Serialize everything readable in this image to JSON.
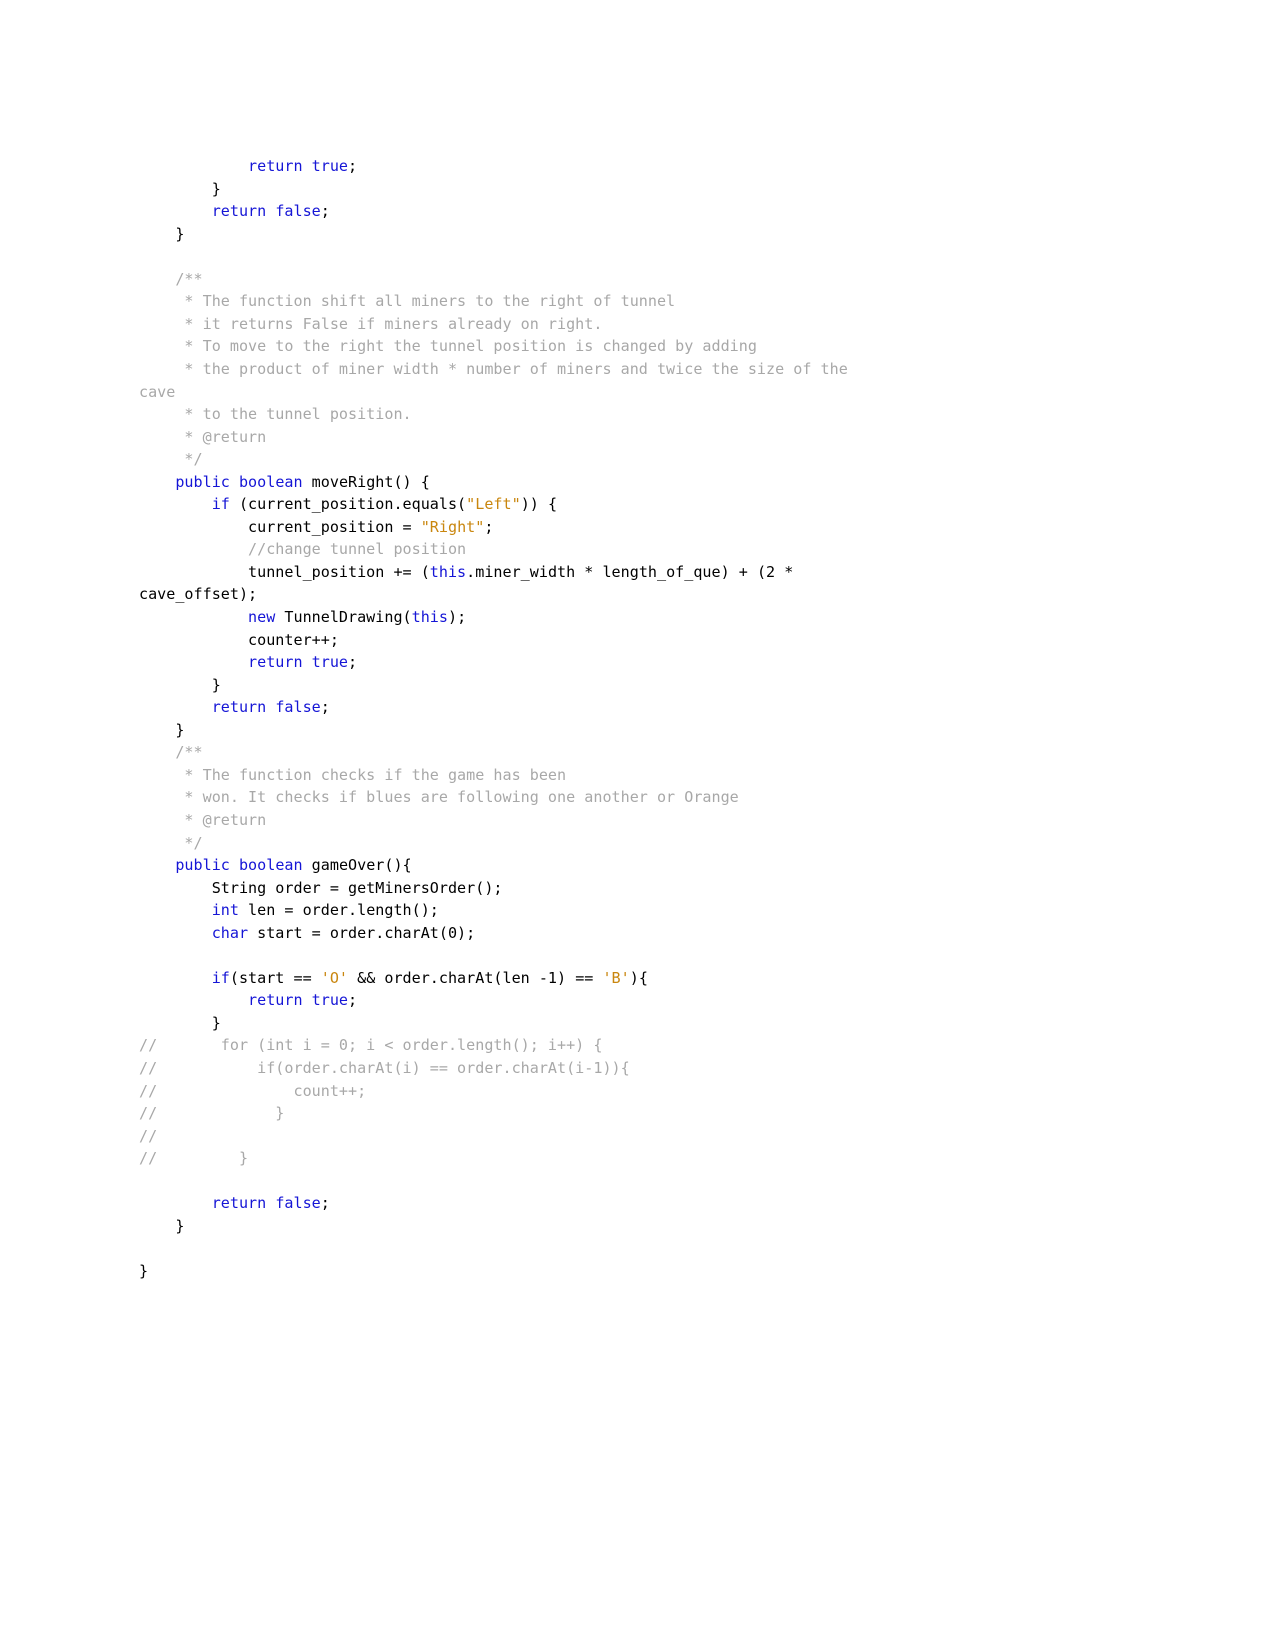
{
  "document": {
    "type": "source-code-listing",
    "language": "Java",
    "background_color": "#ffffff",
    "theme": {
      "plain_color": "#000000",
      "keyword_color": "#1515d6",
      "string_color": "#c9860e",
      "comment_color": "#a8a8a8"
    }
  },
  "code": {
    "lines": [
      {
        "id": 1,
        "indent": 12,
        "tokens": [
          {
            "t": "return",
            "c": "kw"
          },
          {
            "t": " ",
            "c": "pl"
          },
          {
            "t": "true",
            "c": "kw"
          },
          {
            "t": ";",
            "c": "pl"
          }
        ]
      },
      {
        "id": 2,
        "indent": 8,
        "tokens": [
          {
            "t": "}",
            "c": "pl"
          }
        ]
      },
      {
        "id": 3,
        "indent": 8,
        "tokens": [
          {
            "t": "return",
            "c": "kw"
          },
          {
            "t": " ",
            "c": "pl"
          },
          {
            "t": "false",
            "c": "kw"
          },
          {
            "t": ";",
            "c": "pl"
          }
        ]
      },
      {
        "id": 4,
        "indent": 4,
        "tokens": [
          {
            "t": "}",
            "c": "pl"
          }
        ]
      },
      {
        "id": 5,
        "indent": 0,
        "tokens": []
      },
      {
        "id": 6,
        "indent": 4,
        "tokens": [
          {
            "t": "/**",
            "c": "cmt"
          }
        ]
      },
      {
        "id": 7,
        "indent": 5,
        "tokens": [
          {
            "t": "* The function shift all miners to the right of tunnel",
            "c": "cmt"
          }
        ]
      },
      {
        "id": 8,
        "indent": 5,
        "tokens": [
          {
            "t": "* it returns False if miners already on right.",
            "c": "cmt"
          }
        ]
      },
      {
        "id": 9,
        "indent": 5,
        "tokens": [
          {
            "t": "* To move to the right the tunnel position is changed by adding",
            "c": "cmt"
          }
        ]
      },
      {
        "id": 10,
        "indent": 5,
        "tokens": [
          {
            "t": "* the product of miner width * number of miners and twice the size of the",
            "c": "cmt"
          }
        ]
      },
      {
        "id": 11,
        "indent": 0,
        "tokens": [
          {
            "t": "cave",
            "c": "cmt"
          }
        ]
      },
      {
        "id": 12,
        "indent": 5,
        "tokens": [
          {
            "t": "* to the tunnel position.",
            "c": "cmt"
          }
        ]
      },
      {
        "id": 13,
        "indent": 5,
        "tokens": [
          {
            "t": "* @return",
            "c": "cmt"
          }
        ]
      },
      {
        "id": 14,
        "indent": 5,
        "tokens": [
          {
            "t": "*/",
            "c": "cmt"
          }
        ]
      },
      {
        "id": 15,
        "indent": 4,
        "tokens": [
          {
            "t": "public",
            "c": "kw"
          },
          {
            "t": " ",
            "c": "pl"
          },
          {
            "t": "boolean",
            "c": "kw"
          },
          {
            "t": " moveRight() {",
            "c": "pl"
          }
        ]
      },
      {
        "id": 16,
        "indent": 8,
        "tokens": [
          {
            "t": "if",
            "c": "kw"
          },
          {
            "t": " (current_position.equals(",
            "c": "pl"
          },
          {
            "t": "\"Left\"",
            "c": "str"
          },
          {
            "t": ")) {",
            "c": "pl"
          }
        ]
      },
      {
        "id": 17,
        "indent": 12,
        "tokens": [
          {
            "t": "current_position = ",
            "c": "pl"
          },
          {
            "t": "\"Right\"",
            "c": "str"
          },
          {
            "t": ";",
            "c": "pl"
          }
        ]
      },
      {
        "id": 18,
        "indent": 12,
        "tokens": [
          {
            "t": "//change tunnel position",
            "c": "cmt"
          }
        ]
      },
      {
        "id": 19,
        "indent": 12,
        "tokens": [
          {
            "t": "tunnel_position += (",
            "c": "pl"
          },
          {
            "t": "this",
            "c": "kw"
          },
          {
            "t": ".miner_width * length_of_que) + (2 *",
            "c": "pl"
          }
        ]
      },
      {
        "id": 20,
        "indent": 0,
        "tokens": [
          {
            "t": "cave_offset);",
            "c": "pl"
          }
        ]
      },
      {
        "id": 21,
        "indent": 12,
        "tokens": [
          {
            "t": "new",
            "c": "kw"
          },
          {
            "t": " TunnelDrawing(",
            "c": "pl"
          },
          {
            "t": "this",
            "c": "kw"
          },
          {
            "t": ");",
            "c": "pl"
          }
        ]
      },
      {
        "id": 22,
        "indent": 12,
        "tokens": [
          {
            "t": "counter++;",
            "c": "pl"
          }
        ]
      },
      {
        "id": 23,
        "indent": 12,
        "tokens": [
          {
            "t": "return",
            "c": "kw"
          },
          {
            "t": " ",
            "c": "pl"
          },
          {
            "t": "true",
            "c": "kw"
          },
          {
            "t": ";",
            "c": "pl"
          }
        ]
      },
      {
        "id": 24,
        "indent": 8,
        "tokens": [
          {
            "t": "}",
            "c": "pl"
          }
        ]
      },
      {
        "id": 25,
        "indent": 8,
        "tokens": [
          {
            "t": "return",
            "c": "kw"
          },
          {
            "t": " ",
            "c": "pl"
          },
          {
            "t": "false",
            "c": "kw"
          },
          {
            "t": ";",
            "c": "pl"
          }
        ]
      },
      {
        "id": 26,
        "indent": 4,
        "tokens": [
          {
            "t": "}",
            "c": "pl"
          }
        ]
      },
      {
        "id": 27,
        "indent": 4,
        "tokens": [
          {
            "t": "/**",
            "c": "cmt"
          }
        ]
      },
      {
        "id": 28,
        "indent": 5,
        "tokens": [
          {
            "t": "* The function checks if the game has been",
            "c": "cmt"
          }
        ]
      },
      {
        "id": 29,
        "indent": 5,
        "tokens": [
          {
            "t": "* won. It checks if blues are following one another or Orange",
            "c": "cmt"
          }
        ]
      },
      {
        "id": 30,
        "indent": 5,
        "tokens": [
          {
            "t": "* @return",
            "c": "cmt"
          }
        ]
      },
      {
        "id": 31,
        "indent": 5,
        "tokens": [
          {
            "t": "*/",
            "c": "cmt"
          }
        ]
      },
      {
        "id": 32,
        "indent": 4,
        "tokens": [
          {
            "t": "public",
            "c": "kw"
          },
          {
            "t": " ",
            "c": "pl"
          },
          {
            "t": "boolean",
            "c": "kw"
          },
          {
            "t": " gameOver(){",
            "c": "pl"
          }
        ]
      },
      {
        "id": 33,
        "indent": 8,
        "tokens": [
          {
            "t": "String order = getMinersOrder();",
            "c": "pl"
          }
        ]
      },
      {
        "id": 34,
        "indent": 8,
        "tokens": [
          {
            "t": "int",
            "c": "kw"
          },
          {
            "t": " len = order.length();",
            "c": "pl"
          }
        ]
      },
      {
        "id": 35,
        "indent": 8,
        "tokens": [
          {
            "t": "char",
            "c": "kw"
          },
          {
            "t": " start = order.charAt(0);",
            "c": "pl"
          }
        ]
      },
      {
        "id": 36,
        "indent": 0,
        "tokens": []
      },
      {
        "id": 37,
        "indent": 8,
        "tokens": [
          {
            "t": "if",
            "c": "kw"
          },
          {
            "t": "(start == ",
            "c": "pl"
          },
          {
            "t": "'O'",
            "c": "str"
          },
          {
            "t": " && order.charAt(len -1) == ",
            "c": "pl"
          },
          {
            "t": "'B'",
            "c": "str"
          },
          {
            "t": "){",
            "c": "pl"
          }
        ]
      },
      {
        "id": 38,
        "indent": 12,
        "tokens": [
          {
            "t": "return",
            "c": "kw"
          },
          {
            "t": " ",
            "c": "pl"
          },
          {
            "t": "true",
            "c": "kw"
          },
          {
            "t": ";",
            "c": "pl"
          }
        ]
      },
      {
        "id": 39,
        "indent": 8,
        "tokens": [
          {
            "t": "}",
            "c": "pl"
          }
        ]
      },
      {
        "id": 40,
        "indent": 0,
        "tokens": [
          {
            "t": "//       for (int i = 0; i < order.length(); i++) {",
            "c": "cmt"
          }
        ]
      },
      {
        "id": 41,
        "indent": 0,
        "tokens": [
          {
            "t": "//           if(order.charAt(i) == order.charAt(i-1)){",
            "c": "cmt"
          }
        ]
      },
      {
        "id": 42,
        "indent": 0,
        "tokens": [
          {
            "t": "//               count++;",
            "c": "cmt"
          }
        ]
      },
      {
        "id": 43,
        "indent": 0,
        "tokens": [
          {
            "t": "//             }",
            "c": "cmt"
          }
        ]
      },
      {
        "id": 44,
        "indent": 0,
        "tokens": [
          {
            "t": "//",
            "c": "cmt"
          }
        ]
      },
      {
        "id": 45,
        "indent": 0,
        "tokens": [
          {
            "t": "//         }",
            "c": "cmt"
          }
        ]
      },
      {
        "id": 46,
        "indent": 0,
        "tokens": []
      },
      {
        "id": 47,
        "indent": 8,
        "tokens": [
          {
            "t": "return",
            "c": "kw"
          },
          {
            "t": " ",
            "c": "pl"
          },
          {
            "t": "false",
            "c": "kw"
          },
          {
            "t": ";",
            "c": "pl"
          }
        ]
      },
      {
        "id": 48,
        "indent": 4,
        "tokens": [
          {
            "t": "}",
            "c": "pl"
          }
        ]
      },
      {
        "id": 49,
        "indent": 0,
        "tokens": []
      },
      {
        "id": 50,
        "indent": 0,
        "tokens": [
          {
            "t": "}",
            "c": "pl"
          }
        ]
      }
    ]
  }
}
